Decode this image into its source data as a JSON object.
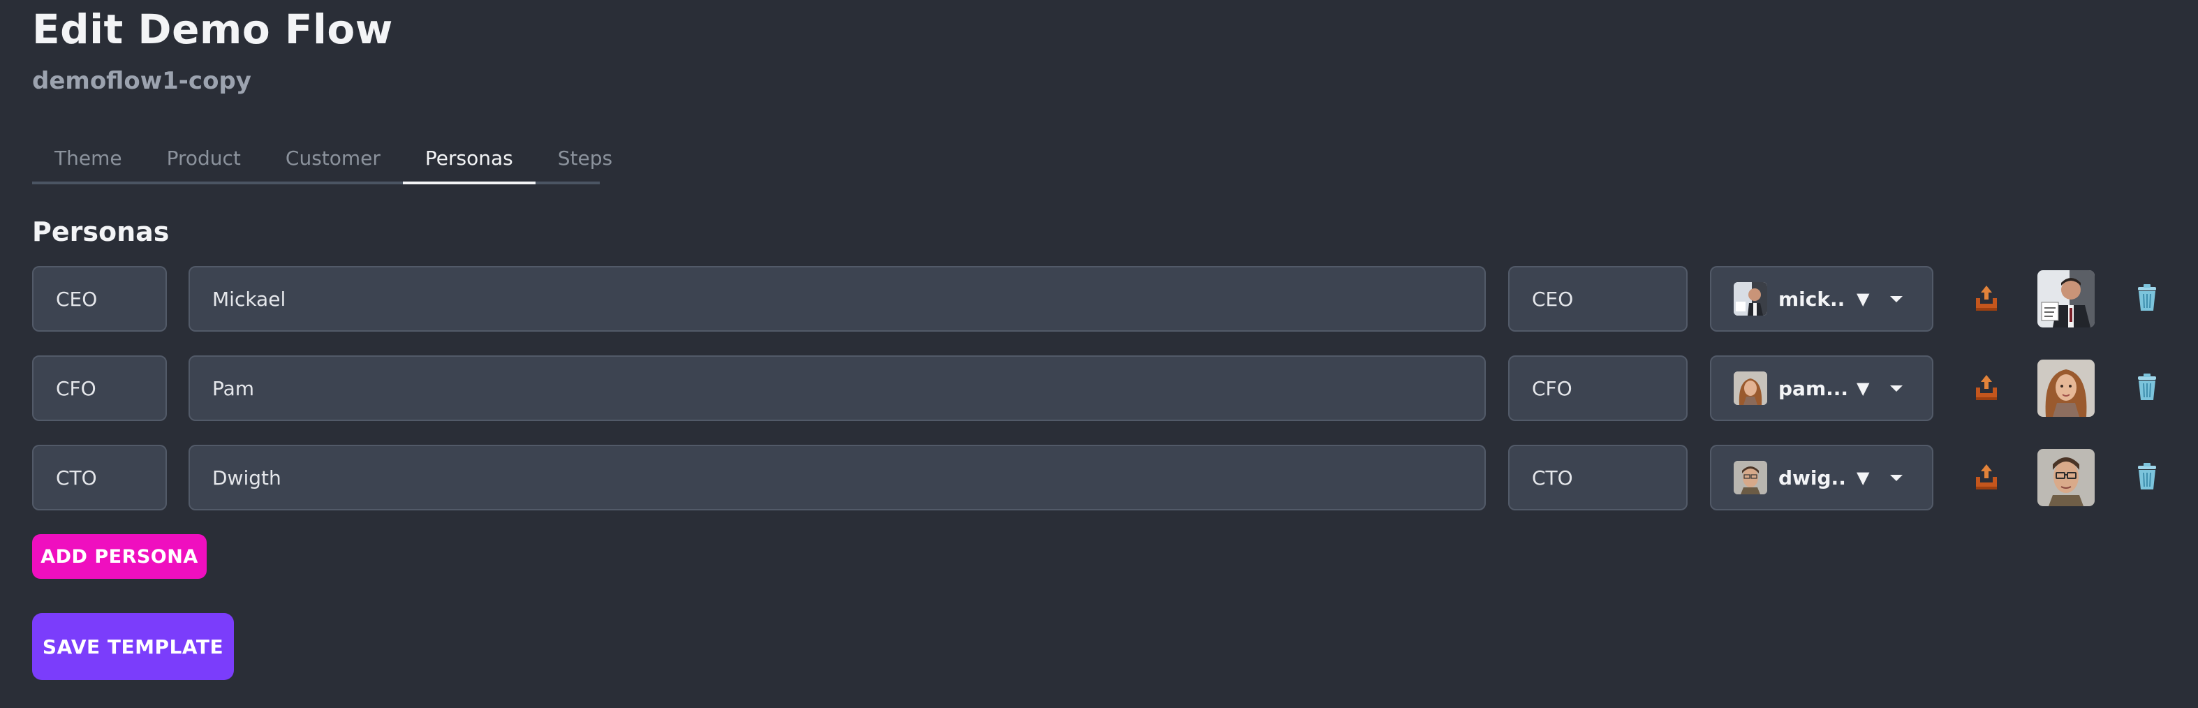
{
  "header": {
    "title": "Edit Demo Flow",
    "subtitle": "demoflow1-copy"
  },
  "tabs": [
    {
      "label": "Theme",
      "active": false
    },
    {
      "label": "Product",
      "active": false
    },
    {
      "label": "Customer",
      "active": false
    },
    {
      "label": "Personas",
      "active": true
    },
    {
      "label": "Steps",
      "active": false
    }
  ],
  "section": {
    "title": "Personas"
  },
  "personas": [
    {
      "key": "CEO",
      "name": "Mickael",
      "role": "CEO",
      "avatar_label": "mick...",
      "caret": "▼"
    },
    {
      "key": "CFO",
      "name": "Pam",
      "role": "CFO",
      "avatar_label": "pam....",
      "caret": "▼"
    },
    {
      "key": "CTO",
      "name": "Dwigth",
      "role": "CTO",
      "avatar_label": "dwig...",
      "caret": "▼"
    }
  ],
  "actions": {
    "add_persona": "ADD PERSONA",
    "save_template": "SAVE TEMPLATE"
  },
  "icons": {
    "upload": "outbox-tray-icon",
    "delete": "wastebasket-icon"
  },
  "colors": {
    "background": "#2a2e37",
    "input_bg": "#3d4451",
    "add_button": "#ef0fbf",
    "save_button": "#7b3dfb"
  }
}
